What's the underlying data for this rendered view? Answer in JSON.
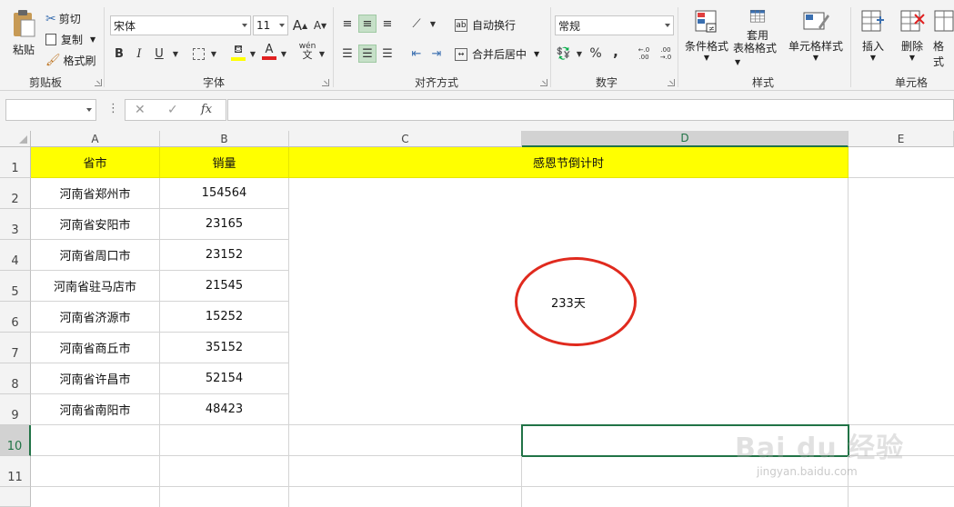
{
  "ribbon": {
    "clipboard": {
      "paste": "粘贴",
      "cut": "剪切",
      "copy": "复制",
      "format_painter": "格式刷",
      "label": "剪贴板"
    },
    "font": {
      "name": "宋体",
      "size": "11",
      "label": "字体",
      "bold": "B",
      "italic": "I",
      "underline": "U",
      "grow": "A",
      "shrink": "A",
      "phonetic": "wén"
    },
    "alignment": {
      "wrap": "自动换行",
      "merge": "合并后居中",
      "label": "对齐方式"
    },
    "number": {
      "format": "常规",
      "percent": "%",
      "comma": ",",
      "label": "数字",
      "inc_decimal": "←.0 .00",
      "dec_decimal": ".00 →.0"
    },
    "styles": {
      "conditional": "条件格式",
      "table_line1": "套用",
      "table_line2": "表格格式",
      "cell_styles": "单元格样式",
      "label": "样式"
    },
    "cells": {
      "insert": "插入",
      "delete": "删除",
      "format": "格式",
      "label": "单元格"
    }
  },
  "formula_bar": {
    "name_box": "",
    "cancel": "✕",
    "enter": "✓",
    "fx": "fx",
    "content": ""
  },
  "columns": [
    "A",
    "B",
    "C",
    "D",
    "E"
  ],
  "rows": [
    "1",
    "2",
    "3",
    "4",
    "5",
    "6",
    "7",
    "8",
    "9",
    "10",
    "11"
  ],
  "header": {
    "a1": "省市",
    "b1": "销量",
    "cd1": "感恩节倒计时"
  },
  "data": [
    {
      "city": "河南省郑州市",
      "sales": "154564"
    },
    {
      "city": "河南省安阳市",
      "sales": "23165"
    },
    {
      "city": "河南省周口市",
      "sales": "23152"
    },
    {
      "city": "河南省驻马店市",
      "sales": "21545"
    },
    {
      "city": "河南省济源市",
      "sales": "15252"
    },
    {
      "city": "河南省商丘市",
      "sales": "35152"
    },
    {
      "city": "河南省许昌市",
      "sales": "52154"
    },
    {
      "city": "河南省南阳市",
      "sales": "48423"
    }
  ],
  "countdown": "233天",
  "colors": {
    "yellow": "#ffff00",
    "accent": "#217346",
    "circle": "#e02a1e"
  },
  "watermark": {
    "brand": "Bai du 经验",
    "url": "jingyan.baidu.com"
  }
}
